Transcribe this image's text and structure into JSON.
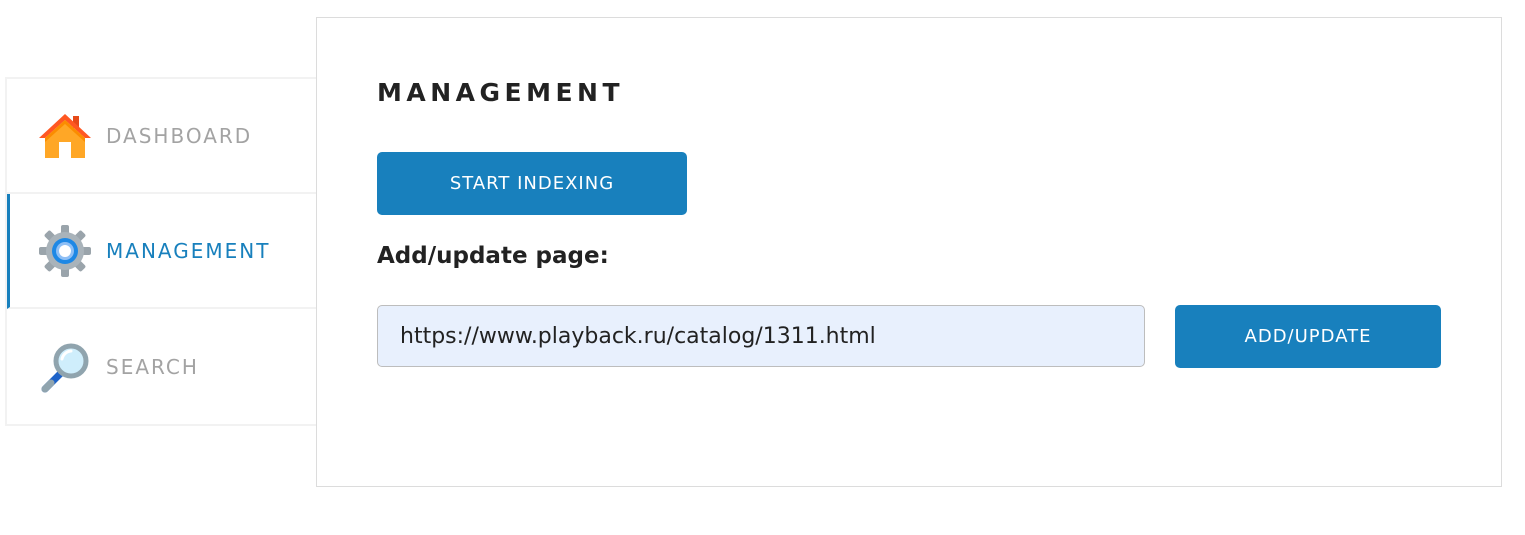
{
  "sidebar": {
    "items": [
      {
        "label": "DASHBOARD",
        "icon": "house-icon",
        "active": false
      },
      {
        "label": "MANAGEMENT",
        "icon": "gear-icon",
        "active": true
      },
      {
        "label": "SEARCH",
        "icon": "magnifier-icon",
        "active": false
      }
    ]
  },
  "main": {
    "title": "MANAGEMENT",
    "start_indexing_label": "START INDEXING",
    "add_update_section_label": "Add/update page:",
    "url_input_value": "https://www.playback.ru/catalog/1311.html",
    "add_update_button_label": "ADD/UPDATE"
  },
  "colors": {
    "accent": "#1880bd",
    "inactive_text": "#a3a3a3",
    "input_bg": "#e8f0fd",
    "border": "#f2f2f2"
  }
}
